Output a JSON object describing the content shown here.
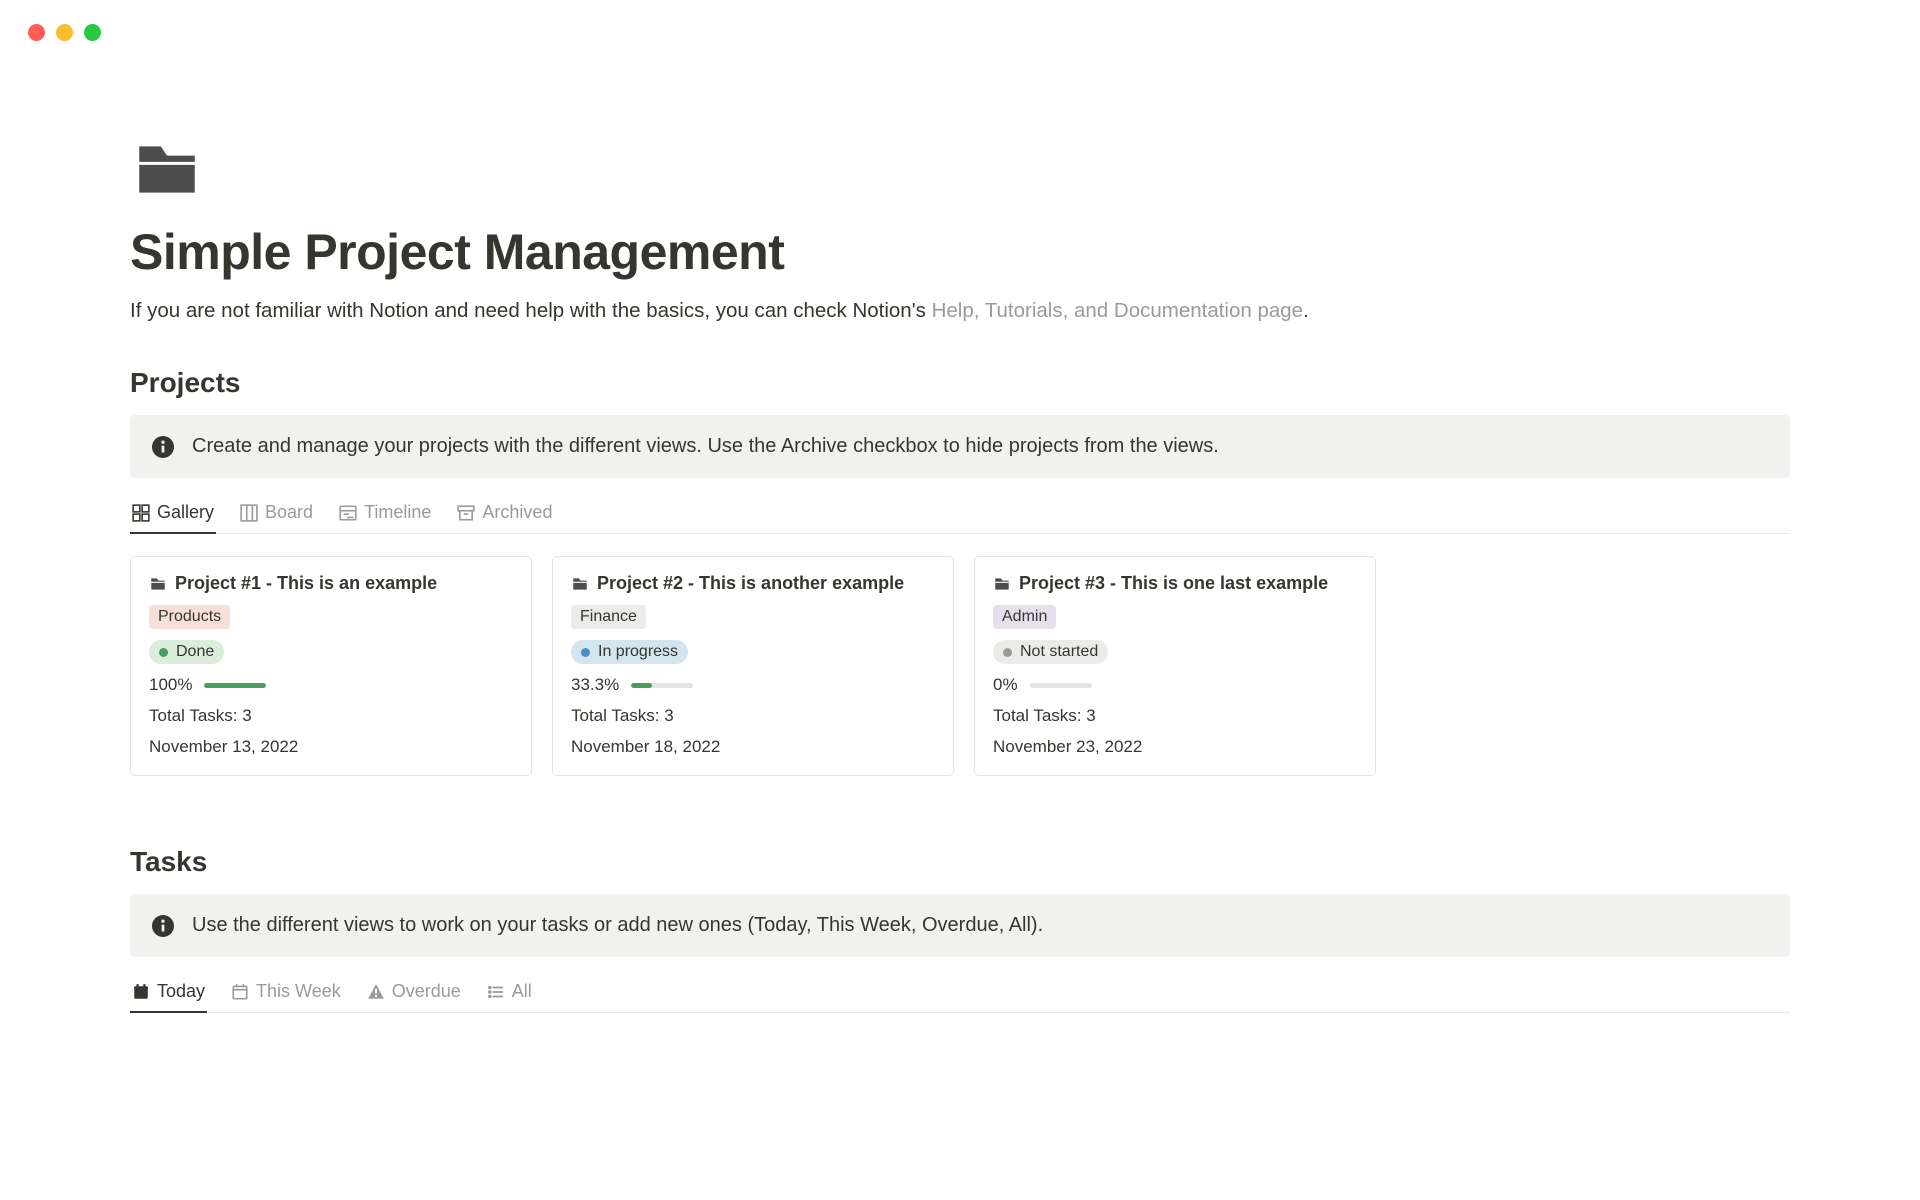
{
  "page": {
    "title": "Simple Project Management",
    "intro_pre": "If you are not familiar with Notion and need help with the basics, you can check Notion's ",
    "intro_link": "Help, Tutorials, and Documentation page",
    "intro_post": "."
  },
  "projects": {
    "heading": "Projects",
    "callout": "Create and manage your projects with the different views. Use the Archive checkbox to hide projects from the views.",
    "tabs": [
      {
        "label": "Gallery",
        "active": true
      },
      {
        "label": "Board",
        "active": false
      },
      {
        "label": "Timeline",
        "active": false
      },
      {
        "label": "Archived",
        "active": false
      }
    ],
    "cards": [
      {
        "title": "Project #1 - This is an example",
        "tag": "Products",
        "tag_class": "products",
        "status": "Done",
        "status_class": "done",
        "percent": "100%",
        "percent_num": 100,
        "total": "Total Tasks: 3",
        "date": "November 13, 2022"
      },
      {
        "title": "Project #2 - This is another example",
        "tag": "Finance",
        "tag_class": "finance",
        "status": "In progress",
        "status_class": "progress",
        "percent": "33.3%",
        "percent_num": 33,
        "total": "Total Tasks: 3",
        "date": "November 18, 2022"
      },
      {
        "title": "Project #3 - This is one last example",
        "tag": "Admin",
        "tag_class": "admin",
        "status": "Not started",
        "status_class": "notstarted",
        "percent": "0%",
        "percent_num": 0,
        "total": "Total Tasks: 3",
        "date": "November 23, 2022"
      }
    ]
  },
  "tasks": {
    "heading": "Tasks",
    "callout": "Use the different views to work on your tasks or add new ones (Today, This Week, Overdue, All).",
    "tabs": [
      {
        "label": "Today",
        "active": true
      },
      {
        "label": "This Week",
        "active": false
      },
      {
        "label": "Overdue",
        "active": false
      },
      {
        "label": "All",
        "active": false
      }
    ]
  }
}
